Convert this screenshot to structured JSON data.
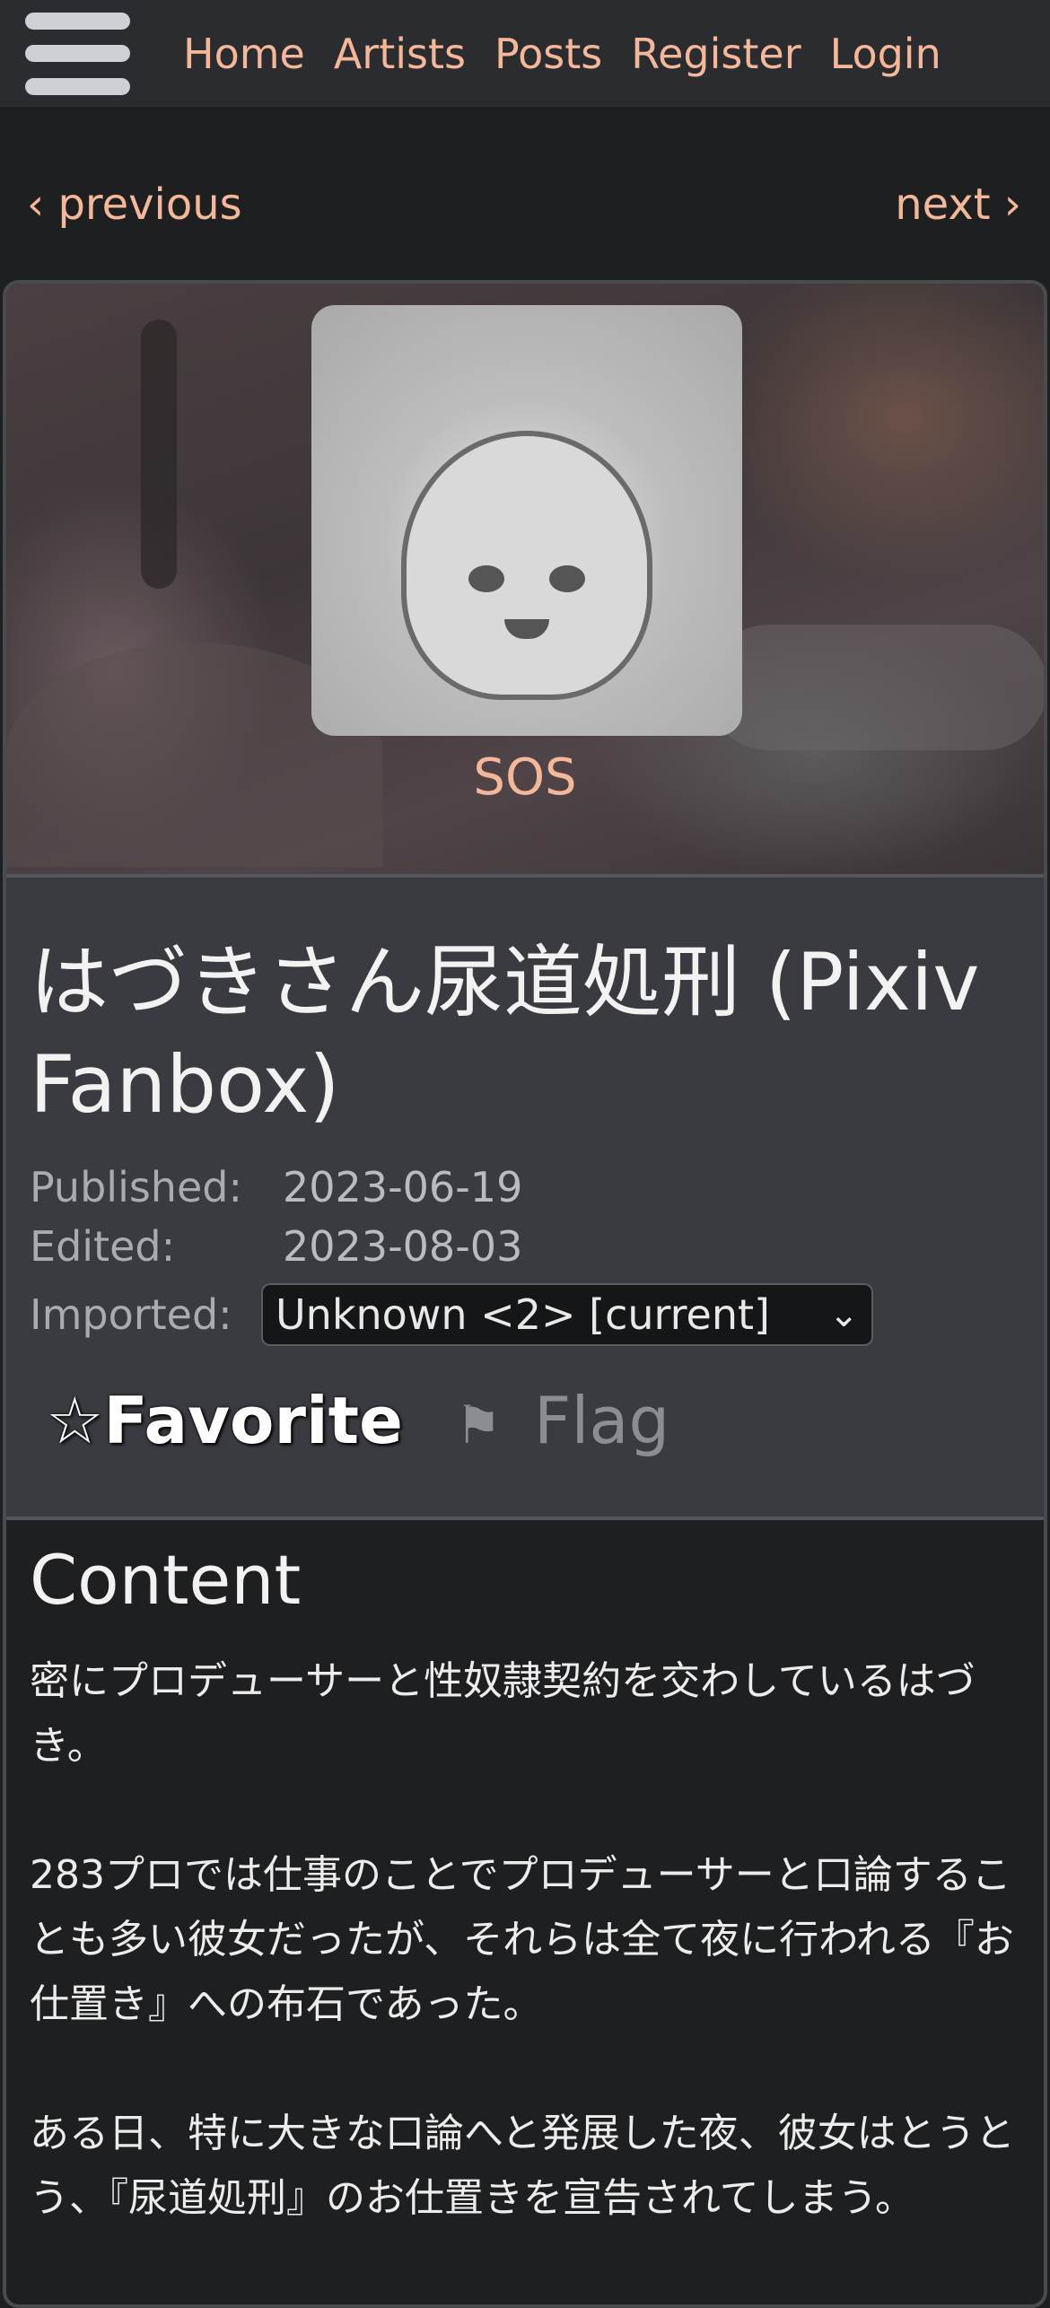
{
  "nav": {
    "menu_icon": "hamburger-menu-icon",
    "links": [
      "Home",
      "Artists",
      "Posts",
      "Register",
      "Login"
    ]
  },
  "pager": {
    "previous": "‹ previous",
    "next": "next ›"
  },
  "artist": {
    "name": "SOS"
  },
  "post": {
    "title": "はづきさん尿道処刑 (Pixiv Fanbox)",
    "published_label": "Published:",
    "published": "2023-06-19",
    "edited_label": "Edited:",
    "edited": "2023-08-03",
    "imported_label": "Imported:",
    "imported_selected": "Unknown <2> [current]",
    "favorite_star": "☆",
    "favorite_label": "Favorite",
    "flag_glyph": "⚑",
    "flag_label": "Flag"
  },
  "content": {
    "heading": "Content",
    "paragraphs": [
      "密にプロデューサーと性奴隷契約を交わしているはづき。",
      "283プロでは仕事のことでプロデューサーと口論することも多い彼女だったが、それらは全て夜に行われる『お仕置き』への布石であった。",
      "ある日、特に大きな口論へと発展した夜、彼女はとうとう、『尿道処刑』のお仕置きを宣告されてしまう。"
    ]
  },
  "colors": {
    "accent": "#f4b799",
    "topbar": "#2b2c2f",
    "background": "#1e1f21",
    "info_panel": "#393b41"
  }
}
